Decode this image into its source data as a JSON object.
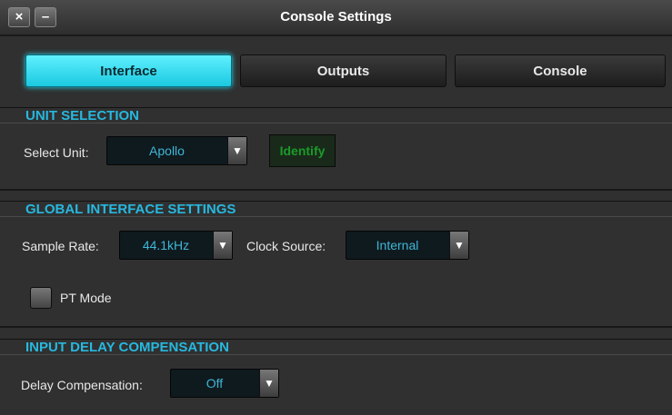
{
  "window": {
    "title": "Console Settings",
    "close_glyph": "×",
    "minimize_glyph": "–"
  },
  "tabs": [
    {
      "label": "Interface",
      "active": true
    },
    {
      "label": "Outputs",
      "active": false
    },
    {
      "label": "Console",
      "active": false
    }
  ],
  "unit_selection": {
    "header": "UNIT SELECTION",
    "select_label": "Select Unit:",
    "unit_value": "Apollo",
    "identify_label": "Identify"
  },
  "global_settings": {
    "header": "GLOBAL INTERFACE SETTINGS",
    "sample_rate_label": "Sample Rate:",
    "sample_rate_value": "44.1kHz",
    "clock_source_label": "Clock Source:",
    "clock_source_value": "Internal",
    "pt_mode_label": "PT Mode"
  },
  "delay": {
    "header": "INPUT DELAY COMPENSATION",
    "label": "Delay Compensation:",
    "value": "Off"
  },
  "icons": {
    "dropdown": "chevron-down-icon"
  },
  "colors": {
    "accent": "#27d9f0",
    "header": "#27b8df",
    "value_text": "#3fb6d6",
    "identify_text": "#1a9b2a"
  }
}
